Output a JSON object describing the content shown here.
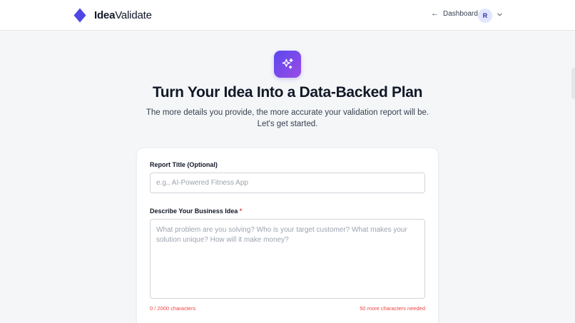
{
  "header": {
    "brand_bold": "Idea",
    "brand_regular": "Validate",
    "dashboard_label": "Dashboard",
    "avatar_initial": "R"
  },
  "hero": {
    "title": "Turn Your Idea Into a Data-Backed Plan",
    "subtitle": "The more details you provide, the more accurate your validation report will be. Let's get started."
  },
  "form": {
    "title_label": "Report Title (Optional)",
    "title_placeholder": "e.g., AI-Powered Fitness App",
    "title_value": "",
    "idea_label": "Describe Your Business Idea",
    "idea_required_marker": "*",
    "idea_placeholder": "What problem are you solving? Who is your target customer? What makes your solution unique? How will it make money?",
    "idea_value": "",
    "char_count": "0 / 2000 characters",
    "chars_needed": "50 more characters needed"
  },
  "icons": {
    "logo": "diamond-logo-icon",
    "back": "arrow-left-icon",
    "caret": "chevron-down-icon",
    "hero": "sparkles-icon"
  },
  "colors": {
    "brand": "#4f46e5",
    "accent_gradient_start": "#5b48ee",
    "accent_gradient_end": "#9b4ce6",
    "error": "#ef4444",
    "background": "#f5f6f8"
  }
}
